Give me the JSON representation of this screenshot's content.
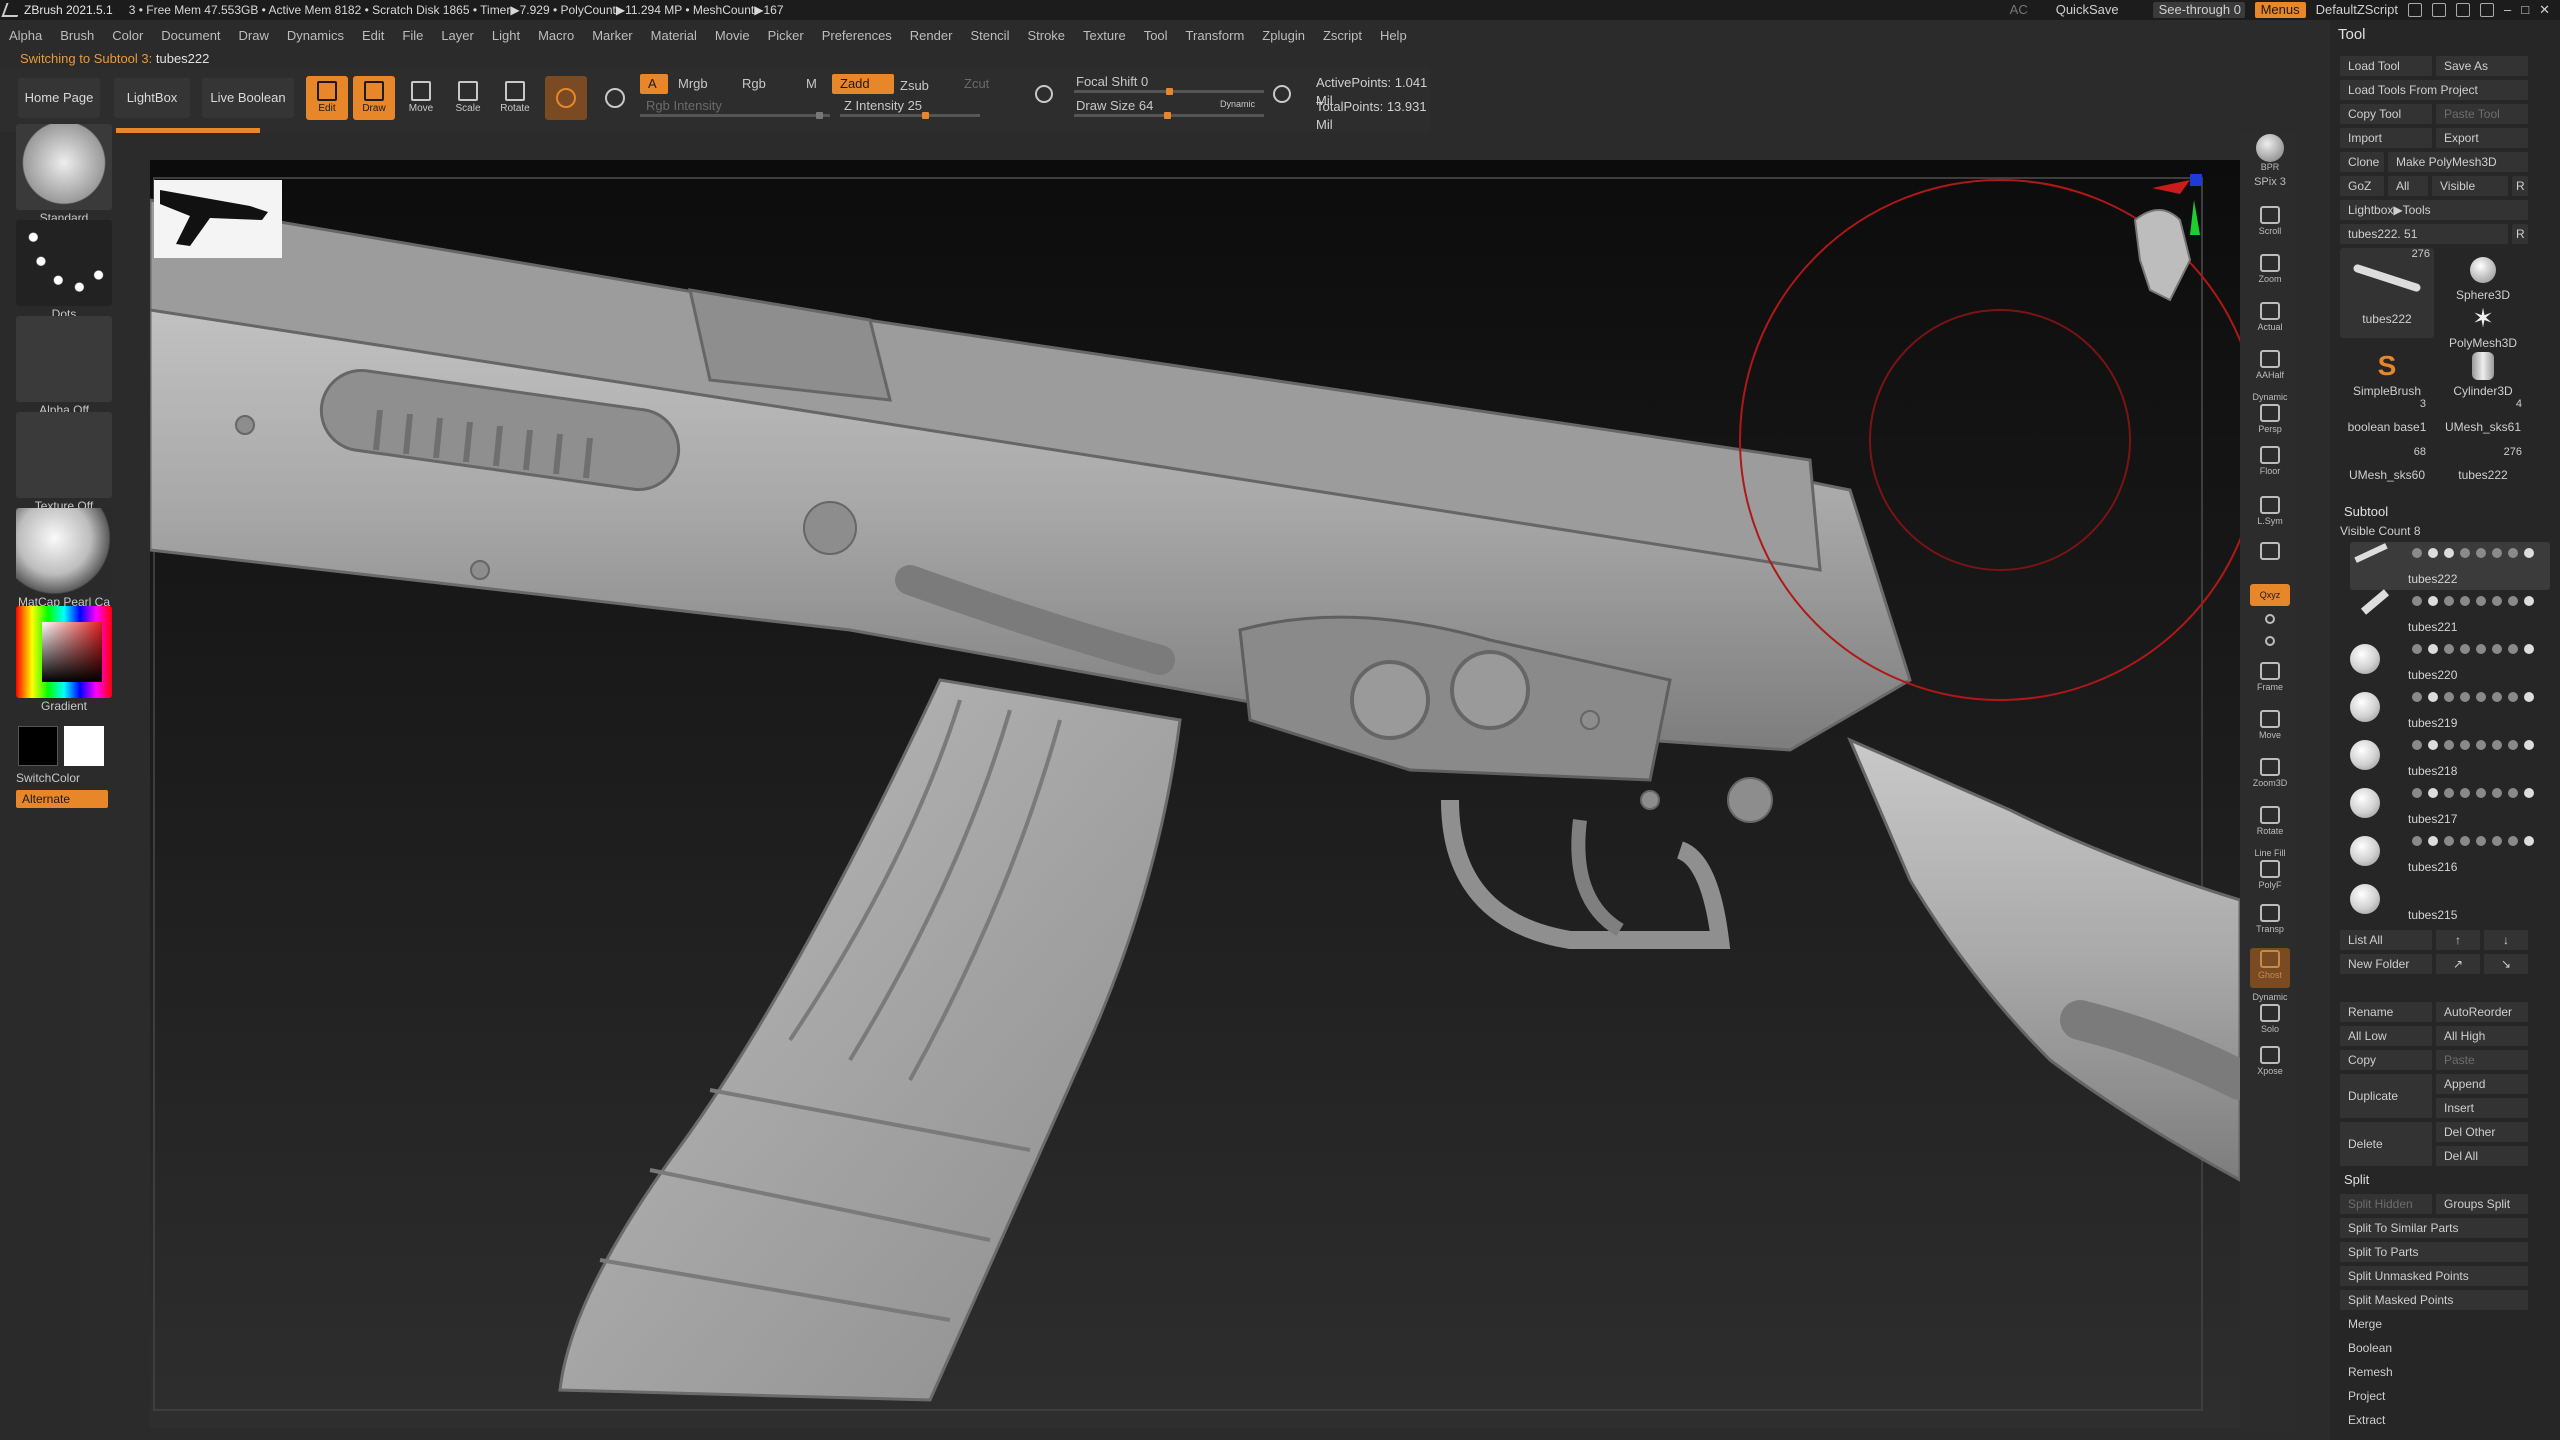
{
  "titlebar": {
    "app": "ZBrush 2021.5.1",
    "status": "3  • Free Mem 47.553GB • Active Mem 8182 • Scratch Disk 1865 •  Timer▶7.929 • PolyCount▶11.294 MP  • MeshCount▶167",
    "ac": "AC",
    "quicksave": "QuickSave",
    "see_through": "See-through  0",
    "menus": "Menus",
    "script": "DefaultZScript"
  },
  "menubar": [
    "Alpha",
    "Brush",
    "Color",
    "Document",
    "Draw",
    "Dynamics",
    "Edit",
    "File",
    "Layer",
    "Light",
    "Macro",
    "Marker",
    "Material",
    "Movie",
    "Picker",
    "Preferences",
    "Render",
    "Stencil",
    "Stroke",
    "Texture",
    "Tool",
    "Transform",
    "Zplugin",
    "Zscript",
    "Help"
  ],
  "subline": {
    "label": "Switching to Subtool 3:",
    "value": "tubes222"
  },
  "toolbar": {
    "home": "Home Page",
    "lightbox": "LightBox",
    "live_boolean": "Live Boolean",
    "edit": "Edit",
    "draw": "Draw",
    "move": "Move",
    "scale": "Scale",
    "rotate": "Rotate",
    "a": "A",
    "mrgb": "Mrgb",
    "rgb": "Rgb",
    "m": "M",
    "zadd": "Zadd",
    "zsub": "Zsub",
    "zcut": "Zcut",
    "rgb_intensity": "Rgb Intensity",
    "z_intensity": "Z Intensity 25",
    "focal_shift": "Focal Shift 0",
    "draw_size": "Draw Size 64",
    "dynamic": "Dynamic",
    "active_points": "ActivePoints: 1.041 Mil",
    "total_points": "TotalPoints: 13.931 Mil"
  },
  "lefttray": {
    "brush": "Standard",
    "stroke": "Dots",
    "alpha": "Alpha Off",
    "texture": "Texture Off",
    "material": "MatCap Pearl Ca",
    "gradient": "Gradient",
    "switchcolor": "SwitchColor",
    "alternate": "Alternate"
  },
  "shelf": {
    "bpr": "BPR",
    "spix": "SPix 3",
    "scroll": "Scroll",
    "zoom": "Zoom",
    "actual": "Actual",
    "aahalf": "AAHalf",
    "dynamic": "Dynamic",
    "persp": "Persp",
    "floor": "Floor",
    "lsym": "L.Sym",
    "xyz": "Qxyz",
    "frame": "Frame",
    "move": "Move",
    "zoom3d": "Zoom3D",
    "rotate": "Rotate",
    "linefill": "Line Fill",
    "polyf": "PolyF",
    "transp": "Transp",
    "ghost": "Ghost",
    "dynamic2": "Dynamic",
    "solo": "Solo",
    "xpose": "Xpose"
  },
  "panel": {
    "title": "Tool",
    "load_tool": "Load Tool",
    "save_as": "Save As",
    "load_from_project": "Load Tools From Project",
    "copy_tool": "Copy Tool",
    "paste_tool": "Paste Tool",
    "import": "Import",
    "export": "Export",
    "clone": "Clone",
    "make_polymesh": "Make PolyMesh3D",
    "goz": "GoZ",
    "all": "All",
    "visible": "Visible",
    "r": "R",
    "lightbox_tools": "Lightbox▶Tools",
    "current_tool": "tubes222. 51",
    "current_r": "R",
    "tools": [
      {
        "name": "tubes222",
        "count": "276"
      },
      {
        "name": "Sphere3D",
        "count": ""
      },
      {
        "name": "PolyMesh3D",
        "count": ""
      },
      {
        "name": "SimpleBrush",
        "count": ""
      },
      {
        "name": "Cylinder3D",
        "count": ""
      },
      {
        "name": "boolean base1",
        "count": "3"
      },
      {
        "name": "UMesh_sks61",
        "count": "4"
      },
      {
        "name": "UMesh_sks60",
        "count": "68"
      },
      {
        "name": "tubes222",
        "count": "276"
      }
    ],
    "subtool_title": "Subtool",
    "visible_count": "Visible Count 8",
    "subtools": [
      "tubes222",
      "tubes221",
      "tubes220",
      "tubes219",
      "tubes218",
      "tubes217",
      "tubes216",
      "tubes215"
    ],
    "list_all": "List All",
    "new_folder": "New Folder",
    "rename": "Rename",
    "autoreorder": "AutoReorder",
    "all_low": "All Low",
    "all_high": "All High",
    "copy": "Copy",
    "paste": "Paste",
    "duplicate": "Duplicate",
    "append": "Append",
    "insert": "Insert",
    "delete": "Delete",
    "del_other": "Del Other",
    "del_all": "Del All",
    "split_title": "Split",
    "split_hidden": "Split Hidden",
    "groups_split": "Groups Split",
    "split_similar": "Split To Similar Parts",
    "split_parts": "Split To Parts",
    "split_unmasked": "Split Unmasked Points",
    "split_masked": "Split Masked Points",
    "merge": "Merge",
    "boolean": "Boolean",
    "remesh": "Remesh",
    "project": "Project",
    "extract": "Extract"
  },
  "colors": {
    "accent": "#e8862a",
    "bg": "#2b2b2b",
    "canvas": "#1d1d1d"
  }
}
